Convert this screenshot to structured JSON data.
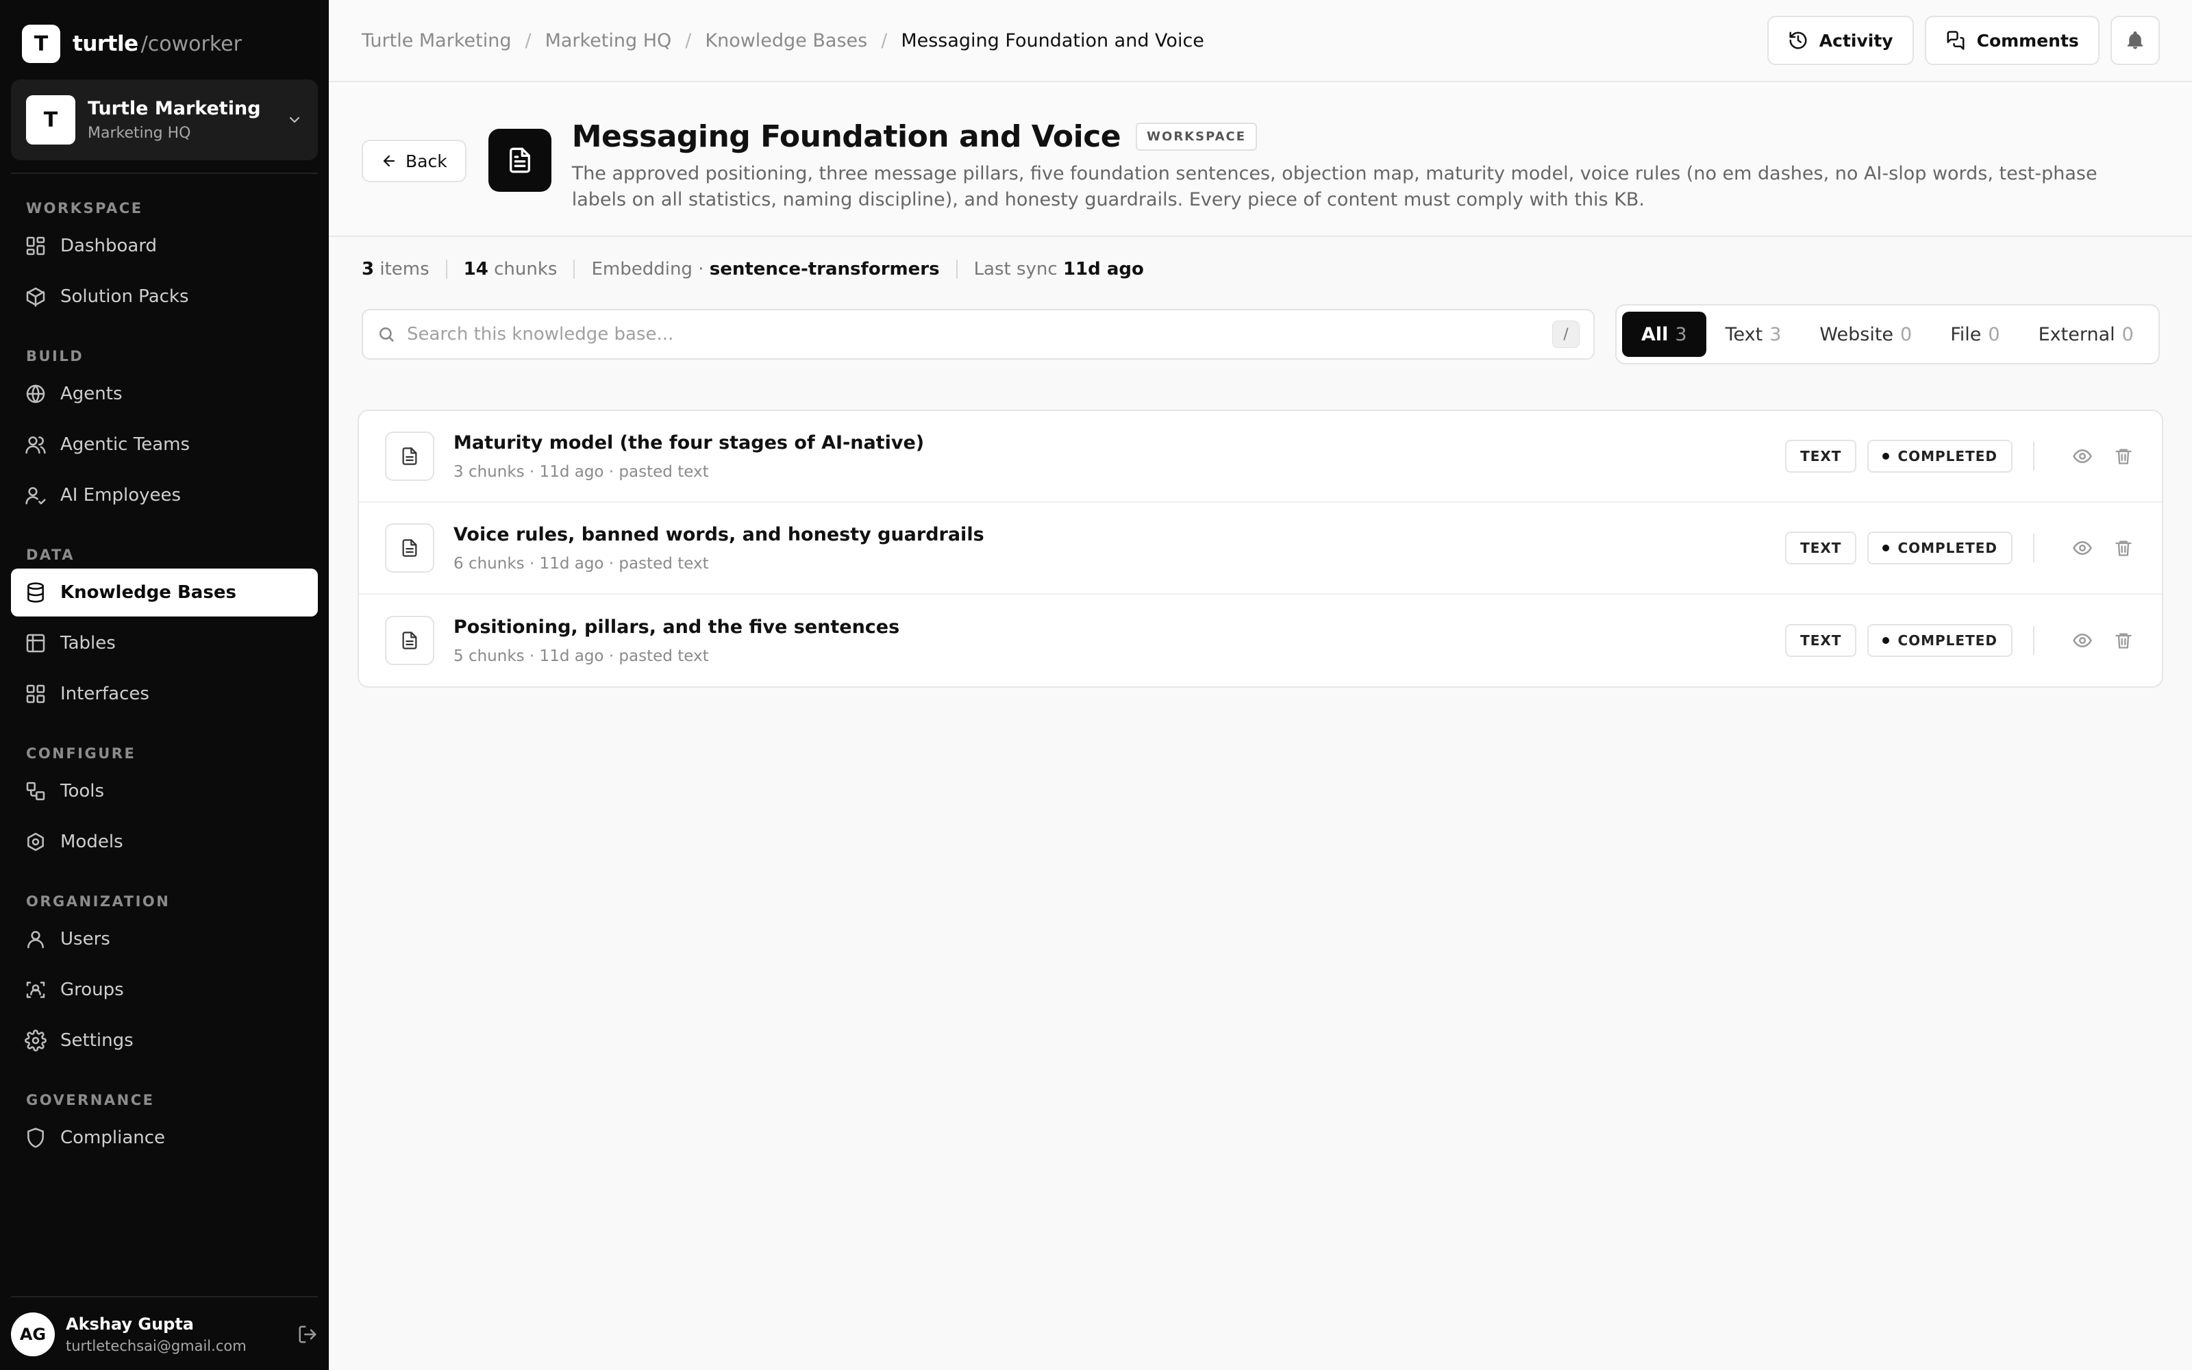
{
  "brand": {
    "name": "turtle",
    "suffix": "/coworker",
    "logo_letter": "T"
  },
  "org": {
    "avatar": "T",
    "name": "Turtle Marketing",
    "sub": "Marketing HQ"
  },
  "nav": {
    "sections": [
      {
        "label": "WORKSPACE",
        "items": [
          {
            "label": "Dashboard",
            "icon": "dashboard-icon"
          },
          {
            "label": "Solution Packs",
            "icon": "package-icon"
          }
        ]
      },
      {
        "label": "BUILD",
        "items": [
          {
            "label": "Agents",
            "icon": "globe-icon"
          },
          {
            "label": "Agentic Teams",
            "icon": "users-icon"
          },
          {
            "label": "AI Employees",
            "icon": "user-check-icon"
          }
        ]
      },
      {
        "label": "DATA",
        "items": [
          {
            "label": "Knowledge Bases",
            "icon": "database-icon",
            "active": true
          },
          {
            "label": "Tables",
            "icon": "table-icon"
          },
          {
            "label": "Interfaces",
            "icon": "layout-icon"
          }
        ]
      },
      {
        "label": "CONFIGURE",
        "items": [
          {
            "label": "Tools",
            "icon": "tools-icon"
          },
          {
            "label": "Models",
            "icon": "models-icon"
          }
        ]
      },
      {
        "label": "ORGANIZATION",
        "items": [
          {
            "label": "Users",
            "icon": "user-icon"
          },
          {
            "label": "Groups",
            "icon": "groups-icon"
          },
          {
            "label": "Settings",
            "icon": "gear-icon"
          }
        ]
      },
      {
        "label": "GOVERNANCE",
        "items": [
          {
            "label": "Compliance",
            "icon": "shield-icon"
          }
        ]
      }
    ]
  },
  "user": {
    "initials": "AG",
    "name": "Akshay Gupta",
    "email": "turtletechsai@gmail.com"
  },
  "breadcrumbs": [
    "Turtle Marketing",
    "Marketing HQ",
    "Knowledge Bases",
    "Messaging Foundation and Voice"
  ],
  "topbar": {
    "activity": "Activity",
    "comments": "Comments"
  },
  "header": {
    "back": "Back",
    "title": "Messaging Foundation and Voice",
    "badge": "WORKSPACE",
    "description": "The approved positioning, three message pillars, five foundation sentences, objection map, maturity model, voice rules (no em dashes, no AI-slop words, test-phase labels on all statistics, naming discipline), and honesty guardrails. Every piece of content must comply with this KB."
  },
  "stats": {
    "items_count": "3",
    "items_label": "items",
    "chunks_count": "14",
    "chunks_label": "chunks",
    "embedding_label": "Embedding ·",
    "embedding_value": "sentence-transformers",
    "sync_label": "Last sync",
    "sync_value": "11d ago"
  },
  "search": {
    "placeholder": "Search this knowledge base...",
    "shortcut": "/"
  },
  "tabs": [
    {
      "label": "All",
      "count": "3",
      "active": true
    },
    {
      "label": "Text",
      "count": "3"
    },
    {
      "label": "Website",
      "count": "0"
    },
    {
      "label": "File",
      "count": "0"
    },
    {
      "label": "External",
      "count": "0"
    }
  ],
  "documents": [
    {
      "title": "Maturity model (the four stages of AI-native)",
      "meta": "3 chunks · 11d ago · pasted text",
      "type": "TEXT",
      "status": "COMPLETED"
    },
    {
      "title": "Voice rules, banned words, and honesty guardrails",
      "meta": "6 chunks · 11d ago · pasted text",
      "type": "TEXT",
      "status": "COMPLETED"
    },
    {
      "title": "Positioning, pillars, and the five sentences",
      "meta": "5 chunks · 11d ago · pasted text",
      "type": "TEXT",
      "status": "COMPLETED"
    }
  ]
}
